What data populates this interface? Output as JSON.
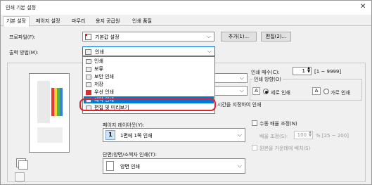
{
  "window": {
    "title": "인쇄 기본 설정",
    "close_glyph": "✕"
  },
  "tabs": [
    "기본 설정",
    "페이지 설정",
    "마무리",
    "용지 공급원",
    "인쇄 품질"
  ],
  "profile": {
    "label": "프로파일(F):",
    "value": "기본값 설정",
    "add_button": "추가(1)...",
    "edit_button": "편집(2)..."
  },
  "output_method": {
    "label": "출력 방법(M):",
    "value": "인쇄"
  },
  "dropdown": {
    "items": [
      "인쇄",
      "보류",
      "보안 인쇄",
      "저장",
      "우선 인쇄",
      "예약 인쇄",
      "편집 및 미리보기"
    ],
    "selected": "예약 인쇄",
    "partial_hint": "시간을 지정하여 인쇄"
  },
  "copies": {
    "label": "인쇄 매수(C):",
    "value": "1",
    "range": "[1 ~ 9999]"
  },
  "orientation": {
    "label": "인쇄 방향(O)",
    "portrait": "세로 인쇄",
    "landscape": "가로 인쇄",
    "selected": "portrait"
  },
  "page_layout": {
    "label": "페이지 레이아웃(Y):",
    "icon_text": "1",
    "value": "1면에 1쪽 인쇄"
  },
  "manual_scaling": {
    "label": "수동 배율 조정(N)",
    "checked": false
  },
  "scaling": {
    "label": "배율 조정(S):",
    "value": "100",
    "range": "% [25 ~ 200]"
  },
  "center_on_page": {
    "label": "원본을 가운데에 배치(S)",
    "checked": false
  },
  "duplex": {
    "label": "단면/양면/소책자 인쇄(T):",
    "value": "양면 인쇄"
  },
  "colors": {
    "highlight": "#e0202a",
    "selection": "#0078d7"
  }
}
